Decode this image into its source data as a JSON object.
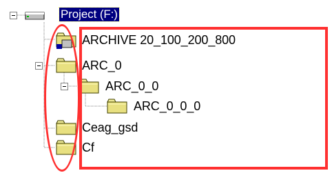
{
  "tree": {
    "root": {
      "label": "Project (F:)",
      "icon": "drive-icon",
      "expanded": true,
      "selected": true
    },
    "items": [
      {
        "label": "ARCHIVE 20_100_200_800",
        "icon": "folder-shared-icon",
        "expanded": false
      },
      {
        "label": "ARC_0",
        "icon": "folder-icon",
        "expanded": true
      },
      {
        "label": "ARC_0_0",
        "icon": "folder-icon",
        "expanded": true
      },
      {
        "label": "ARC_0_0_0",
        "icon": "folder-icon",
        "expanded": false
      },
      {
        "label": "Ceag_gsd",
        "icon": "folder-icon",
        "expanded": false
      },
      {
        "label": "Cf",
        "icon": "folder-icon",
        "expanded": false
      }
    ]
  },
  "annotations": {
    "color": "#ff3030",
    "shapes": [
      "rectangle",
      "ellipse"
    ]
  },
  "colors": {
    "selection": "#000080",
    "folder": "#e8e080",
    "folder_dark": "#808000"
  }
}
